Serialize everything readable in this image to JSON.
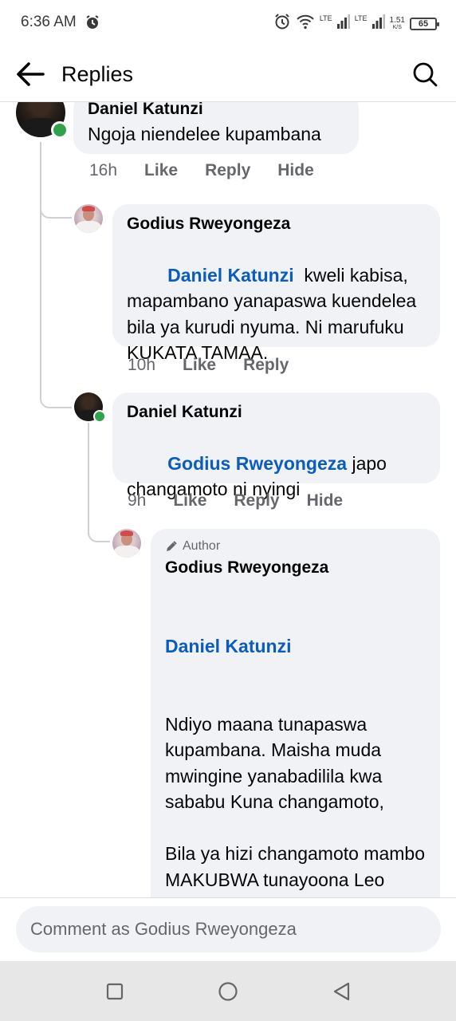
{
  "status_bar": {
    "time": "6:36 AM",
    "lte1": "LTE",
    "lte2": "LTE",
    "speed_value": "1.51",
    "speed_unit": "K/S",
    "battery": "65"
  },
  "header": {
    "title": "Replies",
    "back_icon": "arrow-left-icon",
    "search_icon": "search-icon"
  },
  "comments": [
    {
      "author": "Daniel Katunzi",
      "text": "Ngoja niendelee kupambana",
      "time": "16h",
      "actions": [
        "Like",
        "Reply",
        "Hide"
      ]
    },
    {
      "author": "Godius Rweyongeza",
      "mention": "Daniel Katunzi",
      "text": "  kweli kabisa, mapambano yanapaswa kuendelea bila ya kurudi nyuma. Ni marufuku KUKATA TAMAA.",
      "time": "10h",
      "actions": [
        "Like",
        "Reply"
      ]
    },
    {
      "author": "Daniel Katunzi",
      "mention": "Godius Rweyongeza",
      "text": " japo changamoto ni nyingi",
      "time": "9h",
      "actions": [
        "Like",
        "Reply",
        "Hide"
      ]
    },
    {
      "badge": "Author",
      "author": "Godius Rweyongeza",
      "mention": "Daniel Katunzi",
      "text": "Ndiyo maana tunapaswa kupambana. Maisha muda mwingine yanabadilila kwa sababu Kuna changamoto,\n\nBila ya hizi changamoto mambo MAKUBWA tunayoona Leo tusingekuwa tunayaona.\n\nLeo ngoja nikupe Mifano ya"
    }
  ],
  "composer": {
    "placeholder": "Comment as Godius Rweyongeza"
  },
  "colors": {
    "mention": "#0a5cbf",
    "bubble": "#f0f2f5",
    "online": "#31a24c",
    "meta": "#65676b"
  }
}
